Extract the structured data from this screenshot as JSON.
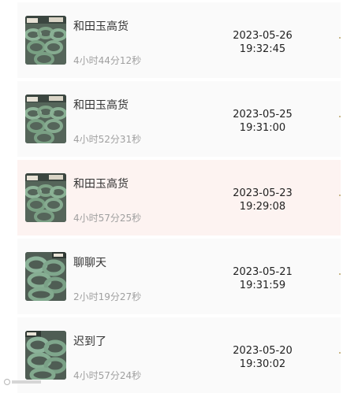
{
  "items": [
    {
      "title": "和田玉高货",
      "duration": "4小时44分12秒",
      "date": "2023-05-26",
      "time": "19:32:45",
      "thumb_icon": "jade-bangles-thumbnail"
    },
    {
      "title": "和田玉高货",
      "duration": "4小时52分31秒",
      "date": "2023-05-25",
      "time": "19:31:00",
      "thumb_icon": "jade-bangles-thumbnail"
    },
    {
      "title": "和田玉高货",
      "duration": "4小时57分25秒",
      "date": "2023-05-23",
      "time": "19:29:08",
      "thumb_icon": "jade-bangles-thumbnail"
    },
    {
      "title": "聊聊天",
      "duration": "2小时19分27秒",
      "date": "2023-05-21",
      "time": "19:31:59",
      "thumb_icon": "jade-bangles-thumbnail"
    },
    {
      "title": "迟到了",
      "duration": "4小时57分24秒",
      "date": "2023-05-20",
      "time": "19:30:02",
      "thumb_icon": "jade-bangles-thumbnail"
    }
  ],
  "colors": {
    "row_background": "#fafafa",
    "highlight_row_background": "#fdf3f1",
    "secondary_text": "#a0a0a0",
    "jade_green": "#7fa387"
  }
}
